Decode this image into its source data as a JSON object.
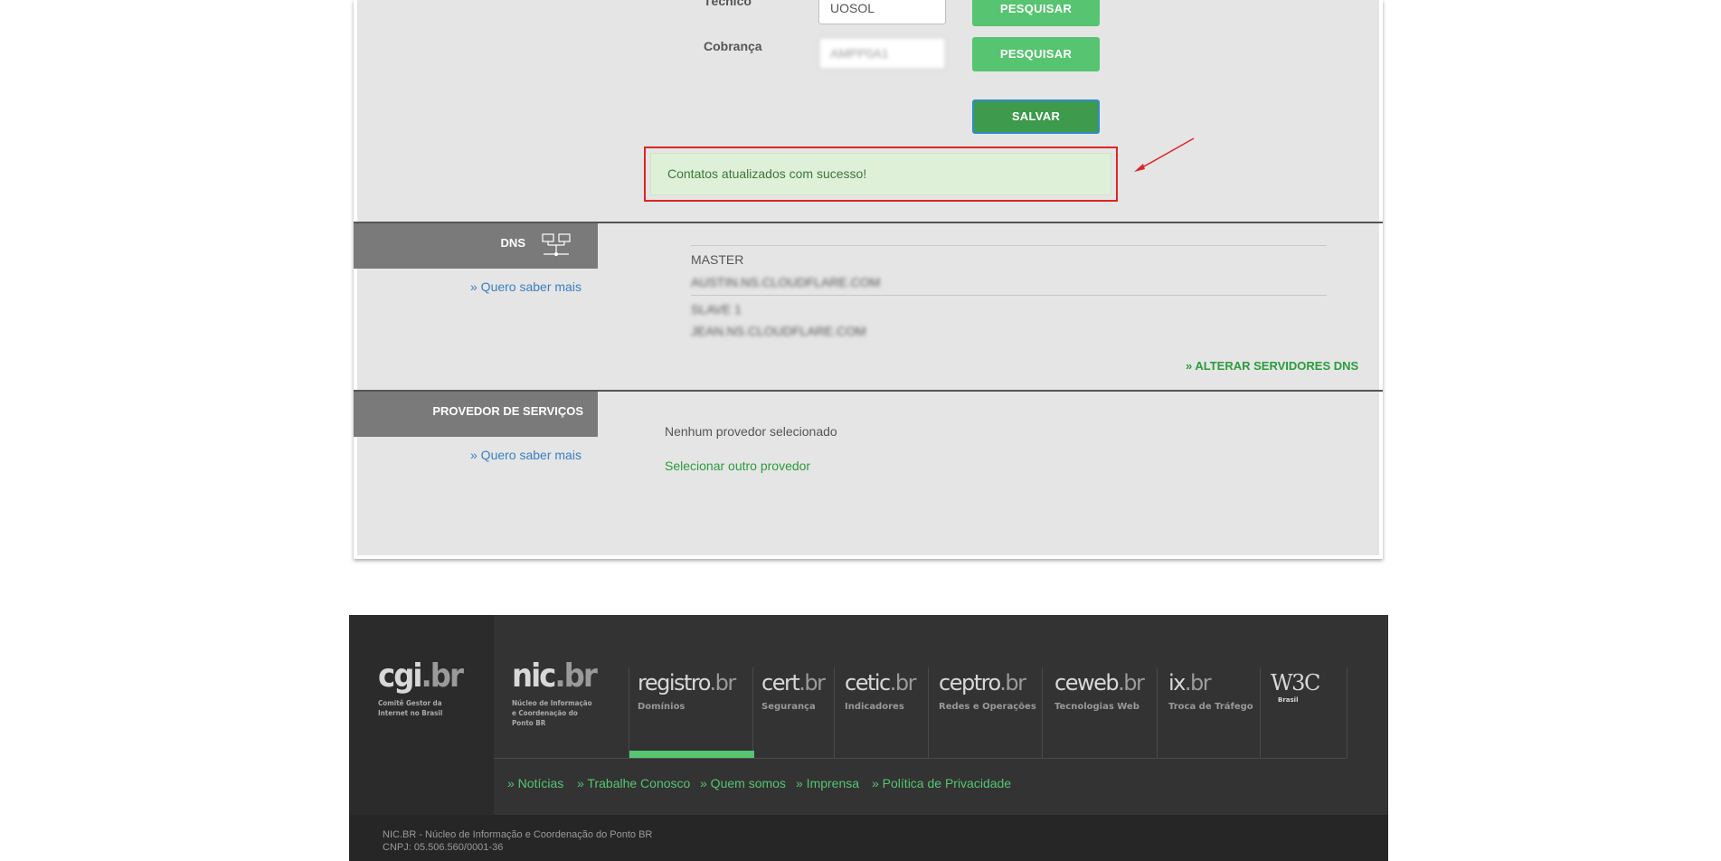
{
  "contacts": {
    "tecnico_label": "Técnico",
    "tecnico_value": "UOSOL",
    "cobranca_label": "Cobrança",
    "cobranca_value": "AMPP0A1",
    "search_label": "PESQUISAR",
    "save_label": "SALVAR",
    "success_message": "Contatos atualizados com sucesso!"
  },
  "dns": {
    "title": "DNS",
    "more_link": "» Quero saber mais",
    "servers": [
      {
        "label": "MASTER",
        "host": "AUSTIN.NS.CLOUDFLARE.COM"
      },
      {
        "label": "SLAVE 1",
        "host": "JEAN.NS.CLOUDFLARE.COM"
      }
    ],
    "change_link": "» ALTERAR SERVIDORES DNS"
  },
  "provider": {
    "title": "PROVEDOR DE SERVIÇOS",
    "more_link": "» Quero saber mais",
    "status": "Nenhum provedor selecionado",
    "select_link": "Selecionar outro provedor"
  },
  "footer": {
    "cgi": {
      "logo_main": "cgi",
      "logo_tld": ".br",
      "subtitle_lines": [
        "Comitê Gestor da",
        "Internet no Brasil"
      ]
    },
    "nic": {
      "logo_main": "nic",
      "logo_tld": ".br",
      "subtitle_lines": [
        "Núcleo de Informação",
        "e Coordenação do",
        "Ponto BR"
      ]
    },
    "brands": [
      {
        "main": "registro",
        "tld": ".br",
        "sub": "Domínios"
      },
      {
        "main": "cert",
        "tld": ".br",
        "sub": "Segurança"
      },
      {
        "main": "cetic",
        "tld": ".br",
        "sub": "Indicadores"
      },
      {
        "main": "ceptro",
        "tld": ".br",
        "sub": "Redes e Operações"
      },
      {
        "main": "ceweb",
        "tld": ".br",
        "sub": "Tecnologias Web"
      },
      {
        "main": "ix",
        "tld": ".br",
        "sub": "Troca de Tráfego"
      }
    ],
    "w3c": {
      "main": "W3C",
      "sub": "Brasil"
    },
    "links": [
      "» Notícias",
      "» Trabalhe Conosco",
      "» Quem somos",
      "» Imprensa",
      "» Política de Privacidade"
    ],
    "copyright_line1": "NIC.BR - Núcleo de Informação e Coordenação do Ponto BR",
    "copyright_line2": "CNPJ: 05.506.560/0001-36"
  },
  "colors": {
    "primary_button": "#56c470",
    "save_button": "#3e9a4c",
    "link_blue": "#3a7fc1",
    "link_green": "#2a9c3d",
    "success_bg": "#dff0d8",
    "highlight_red": "#dd2525"
  }
}
